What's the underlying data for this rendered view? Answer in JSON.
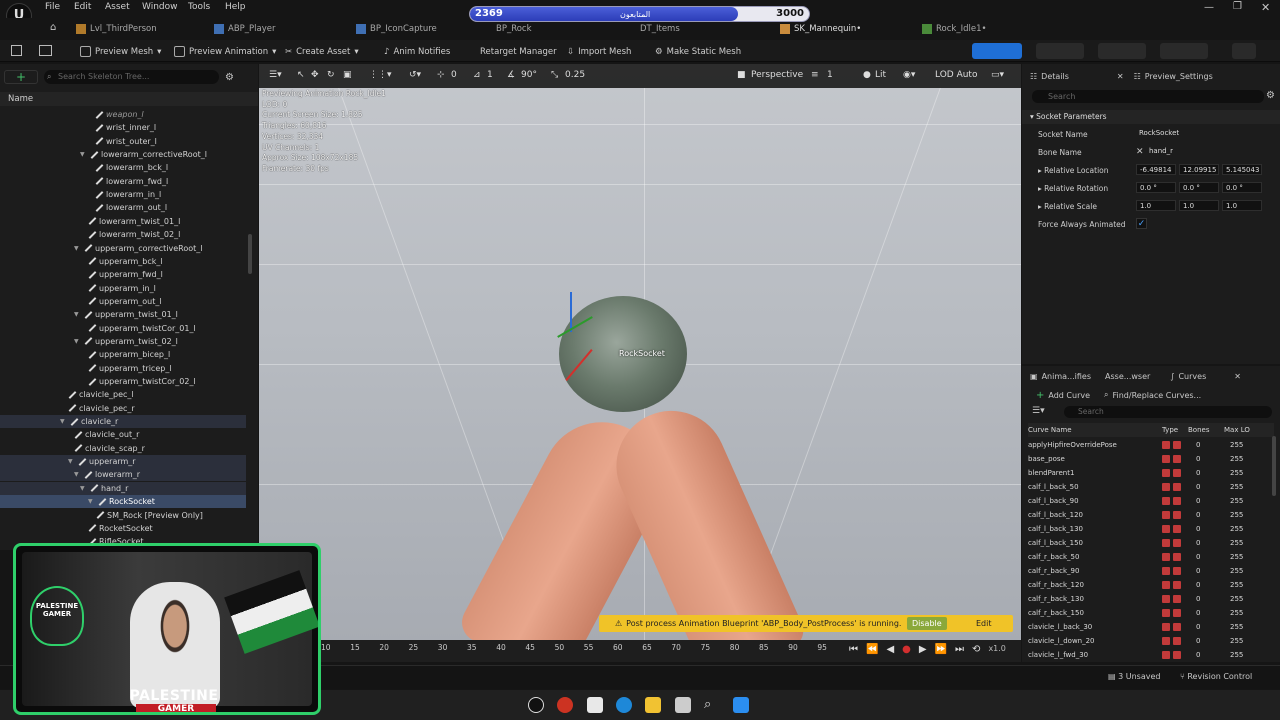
{
  "menu": [
    "File",
    "Edit",
    "Asset",
    "Window",
    "Tools",
    "Help"
  ],
  "tabs": [
    {
      "label": "Lvl_ThirdPerson"
    },
    {
      "label": "ABP_Player"
    },
    {
      "label": "BP_IconCapture"
    },
    {
      "label": "BP_Rock"
    },
    {
      "label": "DT_Items"
    },
    {
      "label": "SK_Mannequin•"
    },
    {
      "label": "Rock_Idle1•"
    }
  ],
  "progress": {
    "left": "2369",
    "right": "3000",
    "mid": "المتابعون",
    "fill": 0.79
  },
  "toolbar": {
    "preview_mesh": "Preview Mesh",
    "preview_animation": "Preview Animation",
    "create_asset": "Create Asset",
    "anim_notifies": "Anim Notifies",
    "retarget_manager": "Retarget Manager",
    "import_mesh": "Import Mesh",
    "make_static_mesh": "Make Static Mesh"
  },
  "skeleton": {
    "search_placeholder": "Search Skeleton Tree...",
    "name_header": "Name",
    "rows": [
      {
        "label": "weapon_l",
        "indent": 95,
        "italic": true
      },
      {
        "label": "wrist_inner_l",
        "indent": 95
      },
      {
        "label": "wrist_outer_l",
        "indent": 95
      },
      {
        "label": "lowerarm_correctiveRoot_l",
        "indent": 80,
        "arrow": true
      },
      {
        "label": "lowerarm_bck_l",
        "indent": 95
      },
      {
        "label": "lowerarm_fwd_l",
        "indent": 95
      },
      {
        "label": "lowerarm_in_l",
        "indent": 95
      },
      {
        "label": "lowerarm_out_l",
        "indent": 95
      },
      {
        "label": "lowerarm_twist_01_l",
        "indent": 88
      },
      {
        "label": "lowerarm_twist_02_l",
        "indent": 88
      },
      {
        "label": "upperarm_correctiveRoot_l",
        "indent": 74,
        "arrow": true
      },
      {
        "label": "upperarm_bck_l",
        "indent": 88
      },
      {
        "label": "upperarm_fwd_l",
        "indent": 88
      },
      {
        "label": "upperarm_in_l",
        "indent": 88
      },
      {
        "label": "upperarm_out_l",
        "indent": 88
      },
      {
        "label": "upperarm_twist_01_l",
        "indent": 74,
        "arrow": true
      },
      {
        "label": "upperarm_twistCor_01_l",
        "indent": 88
      },
      {
        "label": "upperarm_twist_02_l",
        "indent": 74,
        "arrow": true
      },
      {
        "label": "upperarm_bicep_l",
        "indent": 88
      },
      {
        "label": "upperarm_tricep_l",
        "indent": 88
      },
      {
        "label": "upperarm_twistCor_02_l",
        "indent": 88
      },
      {
        "label": "clavicle_pec_l",
        "indent": 68
      },
      {
        "label": "clavicle_pec_r",
        "indent": 68
      },
      {
        "label": "clavicle_r",
        "indent": 60,
        "arrow": true,
        "sel": true
      },
      {
        "label": "clavicle_out_r",
        "indent": 74
      },
      {
        "label": "clavicle_scap_r",
        "indent": 74
      },
      {
        "label": "upperarm_r",
        "indent": 68,
        "arrow": true,
        "sel": true
      },
      {
        "label": "lowerarm_r",
        "indent": 74,
        "arrow": true,
        "sel": true
      },
      {
        "label": "hand_r",
        "indent": 80,
        "arrow": true,
        "sel": true
      },
      {
        "label": "RockSocket",
        "indent": 88,
        "arrow": true,
        "hl": true
      },
      {
        "label": "SM_Rock [Preview Only]",
        "indent": 96
      },
      {
        "label": "RocketSocket",
        "indent": 88
      },
      {
        "label": "RifleSocket",
        "indent": 88
      }
    ]
  },
  "viewport": {
    "perspective": "Perspective",
    "lit": "Lit",
    "lod": "LOD Auto",
    "angle": "90°",
    "scale": "0.25",
    "one": "1",
    "zero": "0",
    "info": [
      "Previewing Animation Rock_Idle1",
      "LOD: 0",
      "Current Screen Size: 1.825",
      "Triangles: 60,816",
      "Vertices: 32,334",
      "UV Channels: 1",
      "Approx Size: 108x72x185",
      "Framerate: 30 fps"
    ],
    "socket_label": "RockSocket",
    "pp_warning": "Post process Animation Blueprint 'ABP_Body_PostProcess' is running.",
    "disable": "Disable",
    "edit": "Edit"
  },
  "timeline": {
    "ticks": [
      "10",
      "15",
      "20",
      "25",
      "30",
      "35",
      "40",
      "45",
      "50",
      "55",
      "60",
      "65",
      "70",
      "75",
      "80",
      "85",
      "90",
      "95"
    ],
    "speed": "x1.0"
  },
  "details": {
    "tab1": "Details",
    "tab2": "Preview_Settings",
    "search_placeholder": "Search",
    "section": "Socket Parameters",
    "socket_name_label": "Socket Name",
    "socket_name": "RockSocket",
    "bone_name_label": "Bone Name",
    "bone_name": "hand_r",
    "rel_loc_label": "Relative Location",
    "rel_loc": [
      "-6.49814",
      "12.09915",
      "5.145043"
    ],
    "rel_rot_label": "Relative Rotation",
    "rel_rot": [
      "0.0 °",
      "0.0 °",
      "0.0 °"
    ],
    "rel_scale_label": "Relative Scale",
    "rel_scale": [
      "1.0",
      "1.0",
      "1.0"
    ],
    "force_label": "Force Always Animated"
  },
  "curves": {
    "tab1": "Anima...ifies",
    "tab2": "Asse...wser",
    "tab3": "Curves",
    "add_curve": "Add Curve",
    "find_replace": "Find/Replace Curves...",
    "search_placeholder": "Search",
    "headers": {
      "name": "Curve Name",
      "type": "Type",
      "bones": "Bones",
      "max_lod": "Max LO"
    },
    "rows": [
      {
        "name": "applyHipfireOverridePose",
        "bones": "0",
        "max": "255"
      },
      {
        "name": "base_pose",
        "bones": "0",
        "max": "255"
      },
      {
        "name": "blendParent1",
        "bones": "0",
        "max": "255"
      },
      {
        "name": "calf_l_back_50",
        "bones": "0",
        "max": "255"
      },
      {
        "name": "calf_l_back_90",
        "bones": "0",
        "max": "255"
      },
      {
        "name": "calf_l_back_120",
        "bones": "0",
        "max": "255"
      },
      {
        "name": "calf_l_back_130",
        "bones": "0",
        "max": "255"
      },
      {
        "name": "calf_l_back_150",
        "bones": "0",
        "max": "255"
      },
      {
        "name": "calf_r_back_50",
        "bones": "0",
        "max": "255"
      },
      {
        "name": "calf_r_back_90",
        "bones": "0",
        "max": "255"
      },
      {
        "name": "calf_r_back_120",
        "bones": "0",
        "max": "255"
      },
      {
        "name": "calf_r_back_130",
        "bones": "0",
        "max": "255"
      },
      {
        "name": "calf_r_back_150",
        "bones": "0",
        "max": "255"
      },
      {
        "name": "clavicle_l_back_30",
        "bones": "0",
        "max": "255"
      },
      {
        "name": "clavicle_l_down_20",
        "bones": "0",
        "max": "255"
      },
      {
        "name": "clavicle_l_fwd_30",
        "bones": "0",
        "max": "255"
      }
    ]
  },
  "status": {
    "unsaved": "3 Unsaved",
    "revision": "Revision Control"
  },
  "cam": {
    "title": "PALESTINE",
    "sub": "GAMER",
    "logo": "PALESTINE GAMER"
  }
}
